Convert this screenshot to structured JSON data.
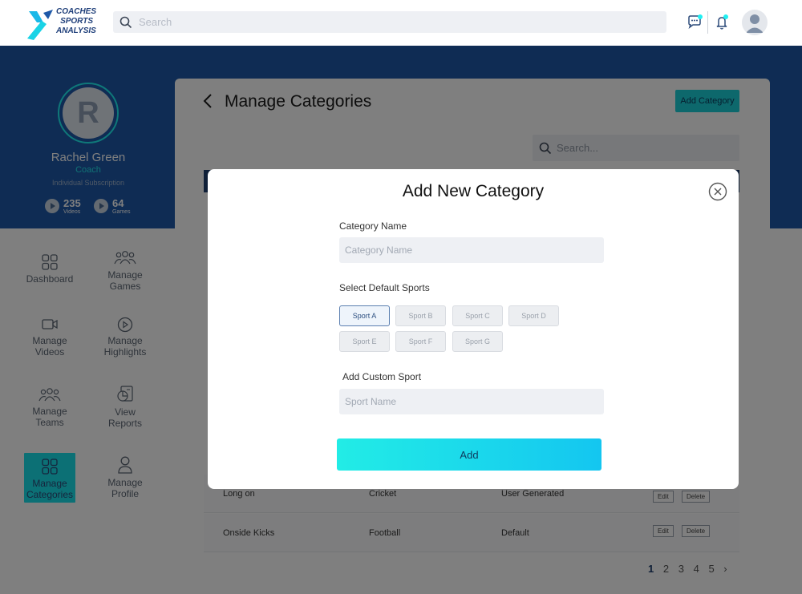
{
  "app": {
    "logo_lines": [
      "COACHES",
      "SPORTS",
      "ANALYSIS"
    ],
    "search_placeholder": "Search",
    "brand_colors": {
      "primary": "#1f59a8",
      "accent": "#1ff0f2",
      "dark": "#1f3f6e"
    }
  },
  "profile": {
    "initial": "R",
    "name": "Rachel Green",
    "role": "Coach",
    "subscription": "Individual Subscription",
    "stats": [
      {
        "value": "235",
        "label": "Videos"
      },
      {
        "value": "64",
        "label": "Games"
      }
    ]
  },
  "nav": [
    {
      "label": "Dashboard",
      "icon": "dashboard-icon"
    },
    {
      "label": "Manage\nGames",
      "icon": "users-group-icon"
    },
    {
      "label": "Manage\nVideos",
      "icon": "video-camera-icon"
    },
    {
      "label": "Manage\nHighlights",
      "icon": "play-circle-icon"
    },
    {
      "label": "Manage\nTeams",
      "icon": "team-icon"
    },
    {
      "label": "View\nReports",
      "icon": "report-icon"
    },
    {
      "label": "Manage\nCategories",
      "icon": "categories-icon",
      "active": true
    },
    {
      "label": "Manage\nProfile",
      "icon": "profile-icon"
    }
  ],
  "page": {
    "title": "Manage Categories",
    "add_button": "Add Category",
    "search_placeholder": "Search...",
    "rows": [
      {
        "name": "Long on",
        "sport": "Cricket",
        "type": "User Generated",
        "edit": "Edit",
        "delete": "Delete"
      },
      {
        "name": "Onside Kicks",
        "sport": "Football",
        "type": "Default",
        "edit": "Edit",
        "delete": "Delete"
      }
    ],
    "pagination": [
      "1",
      "2",
      "3",
      "4",
      "5"
    ]
  },
  "modal": {
    "title": "Add New Category",
    "category_label": "Category Name",
    "category_placeholder": "Category Name",
    "sports_label": "Select Default Sports",
    "sports": [
      {
        "label": "Sport A",
        "selected": true
      },
      {
        "label": "Sport B",
        "selected": false
      },
      {
        "label": "Sport C",
        "selected": false
      },
      {
        "label": "Sport D",
        "selected": false
      },
      {
        "label": "Sport E",
        "selected": false
      },
      {
        "label": "Sport F",
        "selected": false
      },
      {
        "label": "Sport G",
        "selected": false
      }
    ],
    "custom_label": "Add Custom Sport",
    "custom_placeholder": "Sport Name",
    "submit": "Add"
  }
}
